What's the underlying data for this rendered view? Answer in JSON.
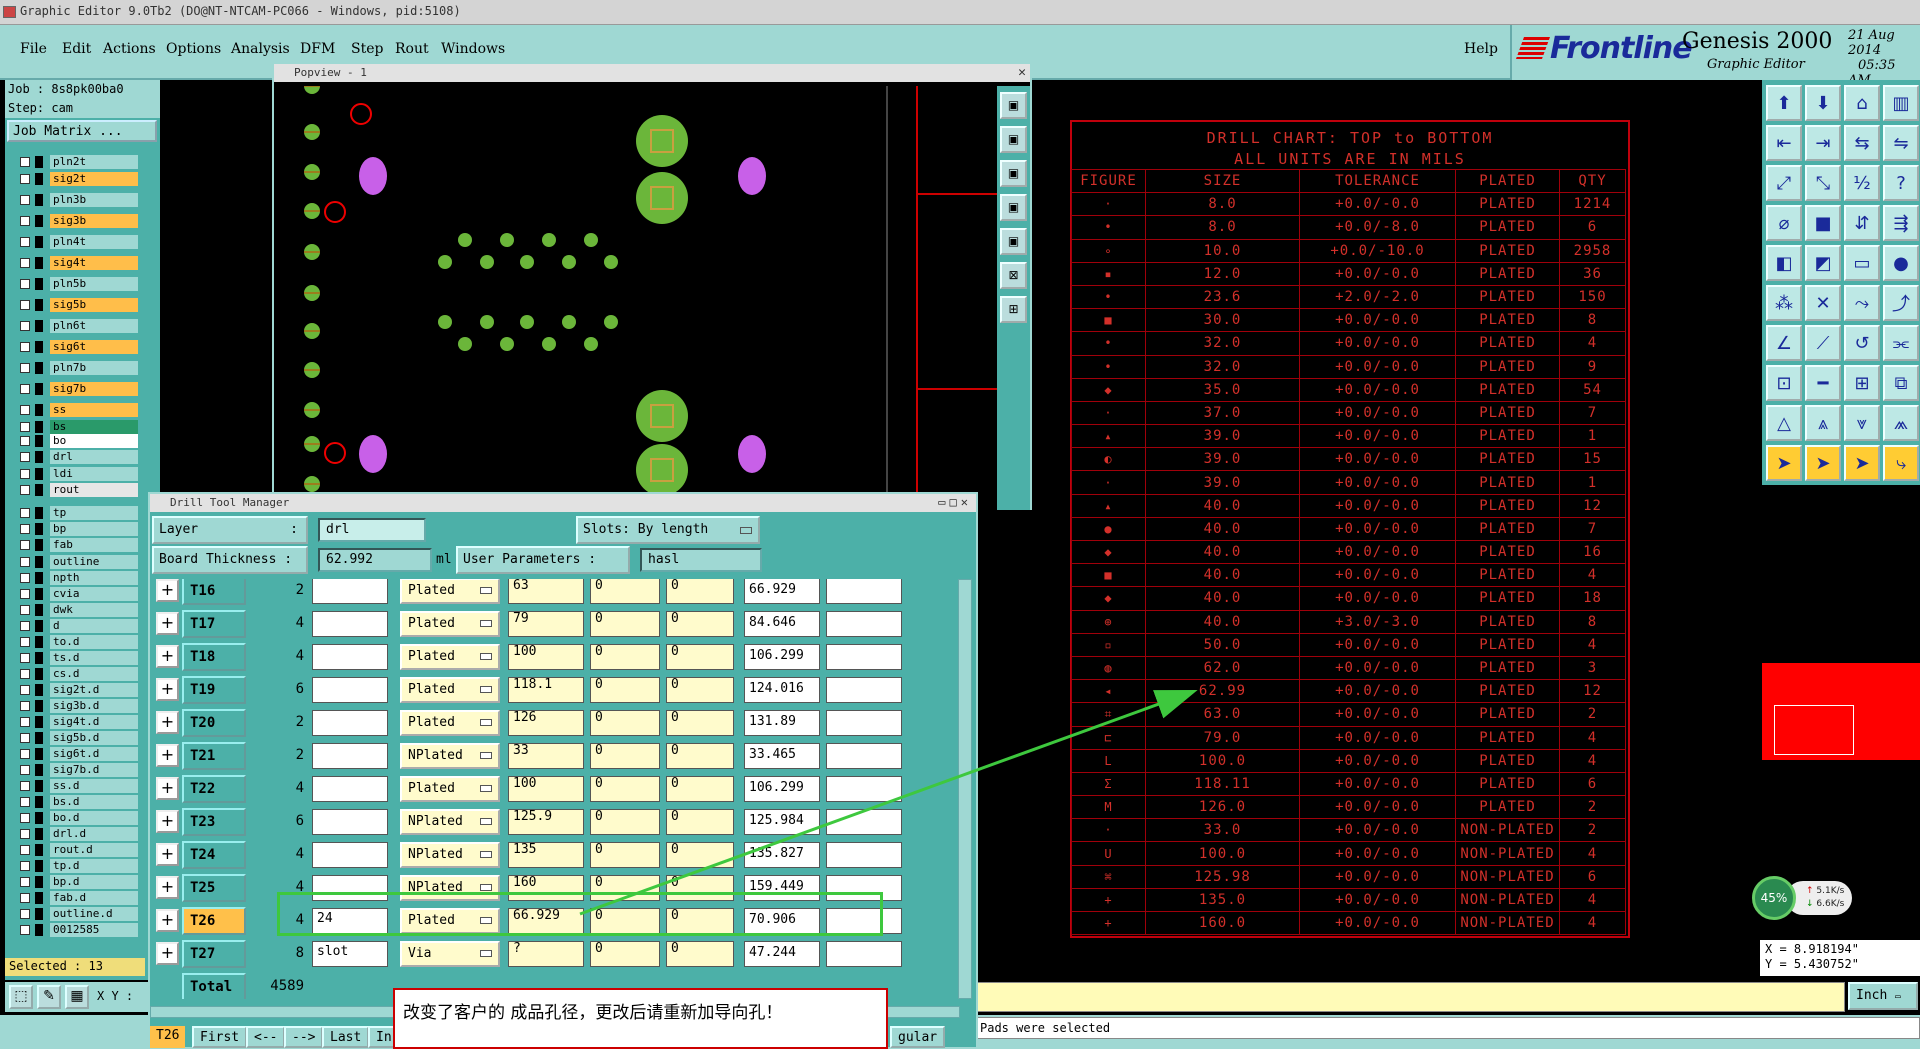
{
  "window": {
    "title": "Graphic Editor 9.0Tb2 (DO@NT-NTCAM-PC066 - Windows, pid:5108)"
  },
  "menu": {
    "items": [
      "File",
      "Edit",
      "Actions",
      "Options",
      "Analysis",
      "DFM",
      "Step",
      "Rout",
      "Windows"
    ],
    "help": "Help"
  },
  "brand": {
    "logo": "Frontline",
    "product": "Genesis 2000",
    "subtitle": "Graphic Editor",
    "date": "21 Aug 2014",
    "time": "05:35 AM"
  },
  "job": {
    "job_label": "Job : 8s8pk00ba0",
    "step_label": "Step: cam",
    "matrix_button": "Job Matrix ..."
  },
  "layers": [
    {
      "name": "pln2t",
      "color": "#9fd8d3"
    },
    {
      "name": "sig2t",
      "color": "#ffbe4a"
    },
    {
      "name": "pln3b",
      "color": "#9fd8d3"
    },
    {
      "name": "sig3b",
      "color": "#ffbe4a"
    },
    {
      "name": "pln4t",
      "color": "#9fd8d3"
    },
    {
      "name": "sig4t",
      "color": "#ffbe4a"
    },
    {
      "name": "pln5b",
      "color": "#9fd8d3"
    },
    {
      "name": "sig5b",
      "color": "#ffbe4a"
    },
    {
      "name": "pln6t",
      "color": "#9fd8d3"
    },
    {
      "name": "sig6t",
      "color": "#ffbe4a"
    },
    {
      "name": "pln7b",
      "color": "#9fd8d3"
    },
    {
      "name": "sig7b",
      "color": "#ffbe4a"
    },
    {
      "name": "ss",
      "color": "#ffbe4a"
    },
    {
      "name": "bs",
      "color": "#2a9a6a"
    },
    {
      "name": "bo",
      "color": "#ffffff"
    },
    {
      "name": "drl",
      "color": "#9fd8d3"
    },
    {
      "name": "ldi",
      "color": "#9fd8d3"
    },
    {
      "name": "rout",
      "color": "#e6e6e6"
    },
    {
      "name": "tp",
      "color": "#9fd8d3"
    },
    {
      "name": "bp",
      "color": "#9fd8d3"
    },
    {
      "name": "fab",
      "color": "#9fd8d3"
    },
    {
      "name": "outline",
      "color": "#9fd8d3"
    },
    {
      "name": "npth",
      "color": "#9fd8d3"
    },
    {
      "name": "cvia",
      "color": "#9fd8d3"
    },
    {
      "name": "dwk",
      "color": "#9fd8d3"
    },
    {
      "name": "d",
      "color": "#9fd8d3"
    },
    {
      "name": "to.d",
      "color": "#9fd8d3"
    },
    {
      "name": "ts.d",
      "color": "#9fd8d3"
    },
    {
      "name": "cs.d",
      "color": "#9fd8d3"
    },
    {
      "name": "sig2t.d",
      "color": "#9fd8d3"
    },
    {
      "name": "sig3b.d",
      "color": "#9fd8d3"
    },
    {
      "name": "sig4t.d",
      "color": "#9fd8d3"
    },
    {
      "name": "sig5b.d",
      "color": "#9fd8d3"
    },
    {
      "name": "sig6t.d",
      "color": "#9fd8d3"
    },
    {
      "name": "sig7b.d",
      "color": "#9fd8d3"
    },
    {
      "name": "ss.d",
      "color": "#9fd8d3"
    },
    {
      "name": "bs.d",
      "color": "#9fd8d3"
    },
    {
      "name": "bo.d",
      "color": "#9fd8d3"
    },
    {
      "name": "drl.d",
      "color": "#9fd8d3"
    },
    {
      "name": "rout.d",
      "color": "#9fd8d3"
    },
    {
      "name": "tp.d",
      "color": "#9fd8d3"
    },
    {
      "name": "bp.d",
      "color": "#9fd8d3"
    },
    {
      "name": "fab.d",
      "color": "#9fd8d3"
    },
    {
      "name": "outline.d",
      "color": "#9fd8d3"
    },
    {
      "name": "0012585",
      "color": "#9fd8d3"
    }
  ],
  "selected": "Selected : 13",
  "xy_label": "X Y :",
  "popview": {
    "title": "Popview - 1"
  },
  "drill_chart": {
    "title": "DRILL CHART: TOP to BOTTOM",
    "subtitle": "ALL UNITS ARE IN MILS",
    "headers": [
      "FIGURE",
      "SIZE",
      "TOLERANCE",
      "PLATED",
      "QTY"
    ],
    "rows": [
      [
        "·",
        "8.0",
        "+0.0/-0.0",
        "PLATED",
        "1214"
      ],
      [
        "•",
        "8.0",
        "+0.0/-8.0",
        "PLATED",
        "6"
      ],
      [
        "∘",
        "10.0",
        "+0.0/-10.0",
        "PLATED",
        "2958"
      ],
      [
        "▪",
        "12.0",
        "+0.0/-0.0",
        "PLATED",
        "36"
      ],
      [
        "•",
        "23.6",
        "+2.0/-2.0",
        "PLATED",
        "150"
      ],
      [
        "■",
        "30.0",
        "+0.0/-0.0",
        "PLATED",
        "8"
      ],
      [
        "•",
        "32.0",
        "+0.0/-0.0",
        "PLATED",
        "4"
      ],
      [
        "•",
        "32.0",
        "+0.0/-0.0",
        "PLATED",
        "9"
      ],
      [
        "◆",
        "35.0",
        "+0.0/-0.0",
        "PLATED",
        "54"
      ],
      [
        "·",
        "37.0",
        "+0.0/-0.0",
        "PLATED",
        "7"
      ],
      [
        "▴",
        "39.0",
        "+0.0/-0.0",
        "PLATED",
        "1"
      ],
      [
        "◐",
        "39.0",
        "+0.0/-0.0",
        "PLATED",
        "15"
      ],
      [
        "·",
        "39.0",
        "+0.0/-0.0",
        "PLATED",
        "1"
      ],
      [
        "▴",
        "40.0",
        "+0.0/-0.0",
        "PLATED",
        "12"
      ],
      [
        "●",
        "40.0",
        "+0.0/-0.0",
        "PLATED",
        "7"
      ],
      [
        "◆",
        "40.0",
        "+0.0/-0.0",
        "PLATED",
        "16"
      ],
      [
        "■",
        "40.0",
        "+0.0/-0.0",
        "PLATED",
        "4"
      ],
      [
        "◆",
        "40.0",
        "+0.0/-0.0",
        "PLATED",
        "18"
      ],
      [
        "⊕",
        "40.0",
        "+3.0/-3.0",
        "PLATED",
        "8"
      ],
      [
        "▫",
        "50.0",
        "+0.0/-0.0",
        "PLATED",
        "4"
      ],
      [
        "◍",
        "62.0",
        "+0.0/-0.0",
        "PLATED",
        "3"
      ],
      [
        "◂",
        "62.99",
        "+0.0/-0.0",
        "PLATED",
        "12"
      ],
      [
        "⌗",
        "63.0",
        "+0.0/-0.0",
        "PLATED",
        "2"
      ],
      [
        "⊏",
        "79.0",
        "+0.0/-0.0",
        "PLATED",
        "4"
      ],
      [
        "L",
        "100.0",
        "+0.0/-0.0",
        "PLATED",
        "4"
      ],
      [
        "Σ",
        "118.11",
        "+0.0/-0.0",
        "PLATED",
        "6"
      ],
      [
        "M",
        "126.0",
        "+0.0/-0.0",
        "PLATED",
        "2"
      ],
      [
        "·",
        "33.0",
        "+0.0/-0.0",
        "NON-PLATED",
        "2"
      ],
      [
        "U",
        "100.0",
        "+0.0/-0.0",
        "NON-PLATED",
        "4"
      ],
      [
        "⌘",
        "125.98",
        "+0.0/-0.0",
        "NON-PLATED",
        "6"
      ],
      [
        "+",
        "135.0",
        "+0.0/-0.0",
        "NON-PLATED",
        "4"
      ],
      [
        "+",
        "160.0",
        "+0.0/-0.0",
        "NON-PLATED",
        "4"
      ]
    ]
  },
  "dtm": {
    "title": "Drill Tool Manager",
    "layer_label": "Layer",
    "layer_value": "drl",
    "slots_label": "Slots:",
    "slots_value": "By length",
    "thickness_label": "Board Thickness :",
    "thickness_value": "62.992",
    "thickness_unit": "ml",
    "user_params_label": "User Parameters :",
    "user_params_value": "hasl",
    "rows": [
      {
        "tool": "T16",
        "count": "2",
        "c1": "",
        "type": "Plated",
        "finish": "63",
        "tp": "0",
        "tm": "0",
        "drill": "66.929",
        "c7": ""
      },
      {
        "tool": "T17",
        "count": "4",
        "c1": "",
        "type": "Plated",
        "finish": "79",
        "tp": "0",
        "tm": "0",
        "drill": "84.646",
        "c7": ""
      },
      {
        "tool": "T18",
        "count": "4",
        "c1": "",
        "type": "Plated",
        "finish": "100",
        "tp": "0",
        "tm": "0",
        "drill": "106.299",
        "c7": ""
      },
      {
        "tool": "T19",
        "count": "6",
        "c1": "",
        "type": "Plated",
        "finish": "118.1",
        "tp": "0",
        "tm": "0",
        "drill": "124.016",
        "c7": ""
      },
      {
        "tool": "T20",
        "count": "2",
        "c1": "",
        "type": "Plated",
        "finish": "126",
        "tp": "0",
        "tm": "0",
        "drill": "131.89",
        "c7": ""
      },
      {
        "tool": "T21",
        "count": "2",
        "c1": "",
        "type": "NPlated",
        "finish": "33",
        "tp": "0",
        "tm": "0",
        "drill": "33.465",
        "c7": ""
      },
      {
        "tool": "T22",
        "count": "4",
        "c1": "",
        "type": "Plated",
        "finish": "100",
        "tp": "0",
        "tm": "0",
        "drill": "106.299",
        "c7": ""
      },
      {
        "tool": "T23",
        "count": "6",
        "c1": "",
        "type": "NPlated",
        "finish": "125.9",
        "tp": "0",
        "tm": "0",
        "drill": "125.984",
        "c7": ""
      },
      {
        "tool": "T24",
        "count": "4",
        "c1": "",
        "type": "NPlated",
        "finish": "135",
        "tp": "0",
        "tm": "0",
        "drill": "135.827",
        "c7": ""
      },
      {
        "tool": "T25",
        "count": "4",
        "c1": "",
        "type": "NPlated",
        "finish": "160",
        "tp": "0",
        "tm": "0",
        "drill": "159.449",
        "c7": ""
      },
      {
        "tool": "T26",
        "count": "4",
        "c1": "24",
        "type": "Plated",
        "finish": "66.929",
        "tp": "0",
        "tm": "0",
        "drill": "70.906",
        "c7": ""
      },
      {
        "tool": "T27",
        "count": "8",
        "c1": "slot",
        "type": "Via",
        "finish": "?",
        "tp": "0",
        "tm": "0",
        "drill": "47.244",
        "c7": ""
      }
    ],
    "total_label": "Total",
    "total_value": "4589",
    "nav": {
      "current": "T26",
      "first": "First",
      "prev": "<--",
      "next": "-->",
      "last": "Last",
      "more": "In",
      "right": "gular"
    }
  },
  "note": "改变了客户的 成品孔径，更改后请重新加导向孔！",
  "status_message": "Pads were selected",
  "units": "Inch",
  "coords": {
    "x": "X = 8.918194\"",
    "y": "Y = 5.430752\""
  },
  "network": {
    "percent": "45%",
    "up": "5.1K/s",
    "down": "6.6K/s"
  }
}
